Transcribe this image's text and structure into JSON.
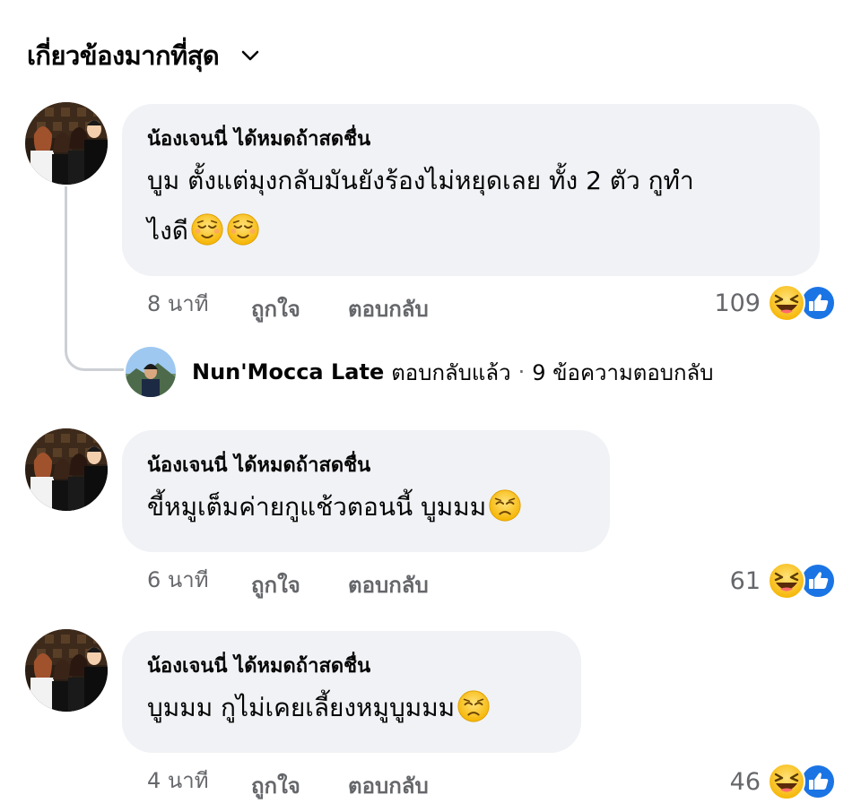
{
  "sort": {
    "label": "เกี่ยวข้องมากที่สุด",
    "icon": "chevron-down-icon"
  },
  "comments": [
    {
      "author": "น้องเจนนี่ ได้หมดถ้าสดชื่น",
      "text_line1": "บูม ตั้งแต่มุงกลับมันยังร้องไม่หยุดเลย ทั้ง 2 ตัว กูทำ",
      "text_line2": "ไงดี",
      "emoji": [
        "relieved-face-icon",
        "relieved-face-icon"
      ],
      "time": "8 นาที",
      "like_label": "ถูกใจ",
      "reply_label": "ตอบกลับ",
      "reaction_count": "109",
      "reactions": [
        "haha-reaction-icon",
        "like-reaction-icon"
      ]
    },
    {
      "author": "น้องเจนนี่ ได้หมดถ้าสดชื่น",
      "text_line1": "ขี้หมูเต็มค่ายกูแช้วตอนนี้ บูมมม",
      "emoji": [
        "disappointed-face-icon"
      ],
      "time": "6 นาที",
      "like_label": "ถูกใจ",
      "reply_label": "ตอบกลับ",
      "reaction_count": "61",
      "reactions": [
        "haha-reaction-icon",
        "like-reaction-icon"
      ]
    },
    {
      "author": "น้องเจนนี่ ได้หมดถ้าสดชื่น",
      "text_line1": "บูมมม กูไม่เคยเลี้ยงหมูบูมมม",
      "emoji": [
        "disappointed-face-icon"
      ],
      "time": "4 นาที",
      "like_label": "ถูกใจ",
      "reply_label": "ตอบกลับ",
      "reaction_count": "46",
      "reactions": [
        "haha-reaction-icon",
        "like-reaction-icon"
      ]
    }
  ],
  "reply_summary": {
    "name": "Nun'Mocca Late",
    "verb": "ตอบกลับแล้ว",
    "separator": "·",
    "count_text": "9 ข้อความตอบกลับ"
  },
  "colors": {
    "bubble": "#f0f2f5",
    "meta_text": "#65676b",
    "primary_text": "#050505",
    "like_blue": "#1b74e4",
    "haha_yellow": "#f7b125",
    "thread_line": "#ccd0d5"
  }
}
